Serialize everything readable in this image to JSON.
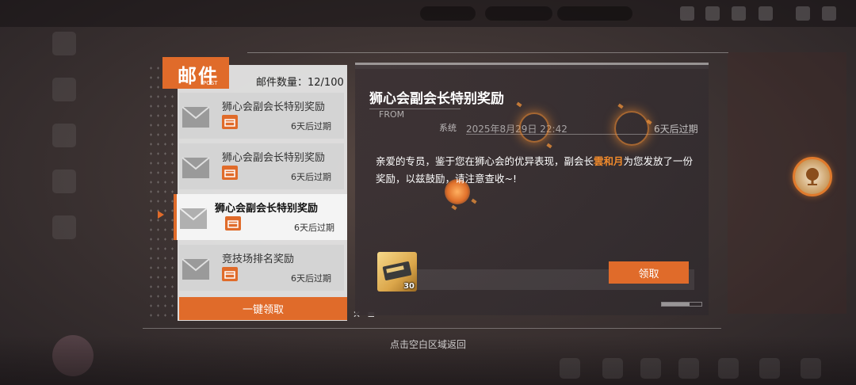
{
  "mail": {
    "title": "邮件",
    "subtitle": "POST",
    "count_label": "邮件数量：12/100",
    "claim_all_label": "一键领取",
    "items": [
      {
        "name": "狮心会副会长特别奖励",
        "expire": "6天后过期"
      },
      {
        "name": "狮心会副会长特别奖励",
        "expire": "6天后过期"
      },
      {
        "name": "狮心会副会长特别奖励",
        "expire": "6天后过期"
      },
      {
        "name": "竞技场排名奖励",
        "expire": "6天后过期"
      }
    ]
  },
  "detail": {
    "title": "狮心会副会长特别奖励",
    "from_label": "FROM",
    "sender": "系统",
    "date": "2025年8月29日 22:42",
    "expire": "6天后过期",
    "body_prefix": "亲爱的专员，鉴于您在狮心会的优异表现，副会长",
    "body_highlight": "雲和月",
    "body_suffix": "为您发放了一份奖励，以兹鼓励，请注意查收~!",
    "reward_quantity": "30",
    "claim_label": "领取"
  },
  "hint": "点击空白区域返回",
  "colors": {
    "accent": "#e06b2a",
    "highlight": "#f08a2c"
  }
}
